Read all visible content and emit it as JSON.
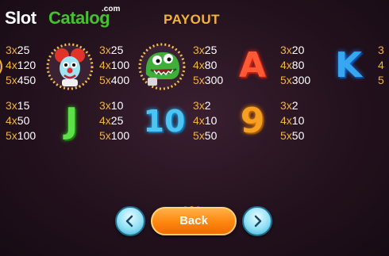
{
  "brand": {
    "slot": "Slot",
    "catalog": "Catalog",
    "com": ".com"
  },
  "header": {
    "title": "PAYOUT"
  },
  "paytable": {
    "row1": [
      {
        "symbol": "partial-symbol-icon",
        "pays": [
          [
            "3x",
            "25"
          ],
          [
            "4x",
            "120"
          ],
          [
            "5x",
            "450"
          ]
        ]
      },
      {
        "symbol": "clown-icon",
        "pays": [
          [
            "3x",
            "25"
          ],
          [
            "4x",
            "100"
          ],
          [
            "5x",
            "400"
          ]
        ]
      },
      {
        "symbol": "green-monster-icon",
        "pays": [
          [
            "3x",
            "25"
          ],
          [
            "4x",
            "80"
          ],
          [
            "5x",
            "300"
          ]
        ]
      },
      {
        "symbol": "letter-a-icon",
        "label": "A",
        "pays": [
          [
            "3x",
            "20"
          ],
          [
            "4x",
            "80"
          ],
          [
            "5x",
            "300"
          ]
        ]
      },
      {
        "symbol": "letter-k-icon",
        "label": "K",
        "pays": []
      }
    ],
    "row2": [
      {
        "symbol": "none",
        "pays": [
          [
            "3x",
            "15"
          ],
          [
            "4x",
            "50"
          ],
          [
            "5x",
            "100"
          ]
        ]
      },
      {
        "symbol": "letter-j-icon",
        "label": "J",
        "pays": [
          [
            "3x",
            "10"
          ],
          [
            "4x",
            "25"
          ],
          [
            "5x",
            "100"
          ]
        ]
      },
      {
        "symbol": "number-10-icon",
        "label": "10",
        "pays": [
          [
            "3x",
            "2"
          ],
          [
            "4x",
            "10"
          ],
          [
            "5x",
            "50"
          ]
        ]
      },
      {
        "symbol": "number-9-icon",
        "label": "9",
        "pays": [
          [
            "3x",
            "2"
          ],
          [
            "4x",
            "10"
          ],
          [
            "5x",
            "50"
          ]
        ]
      }
    ]
  },
  "pagination": {
    "pages": 3,
    "active": 2
  },
  "controls": {
    "back_label": "Back"
  },
  "colors": {
    "accent": "#f2b33a",
    "back_button": "#ff8a12",
    "nav_button": "#8ee0f5",
    "brand_green": "#46c02e"
  }
}
